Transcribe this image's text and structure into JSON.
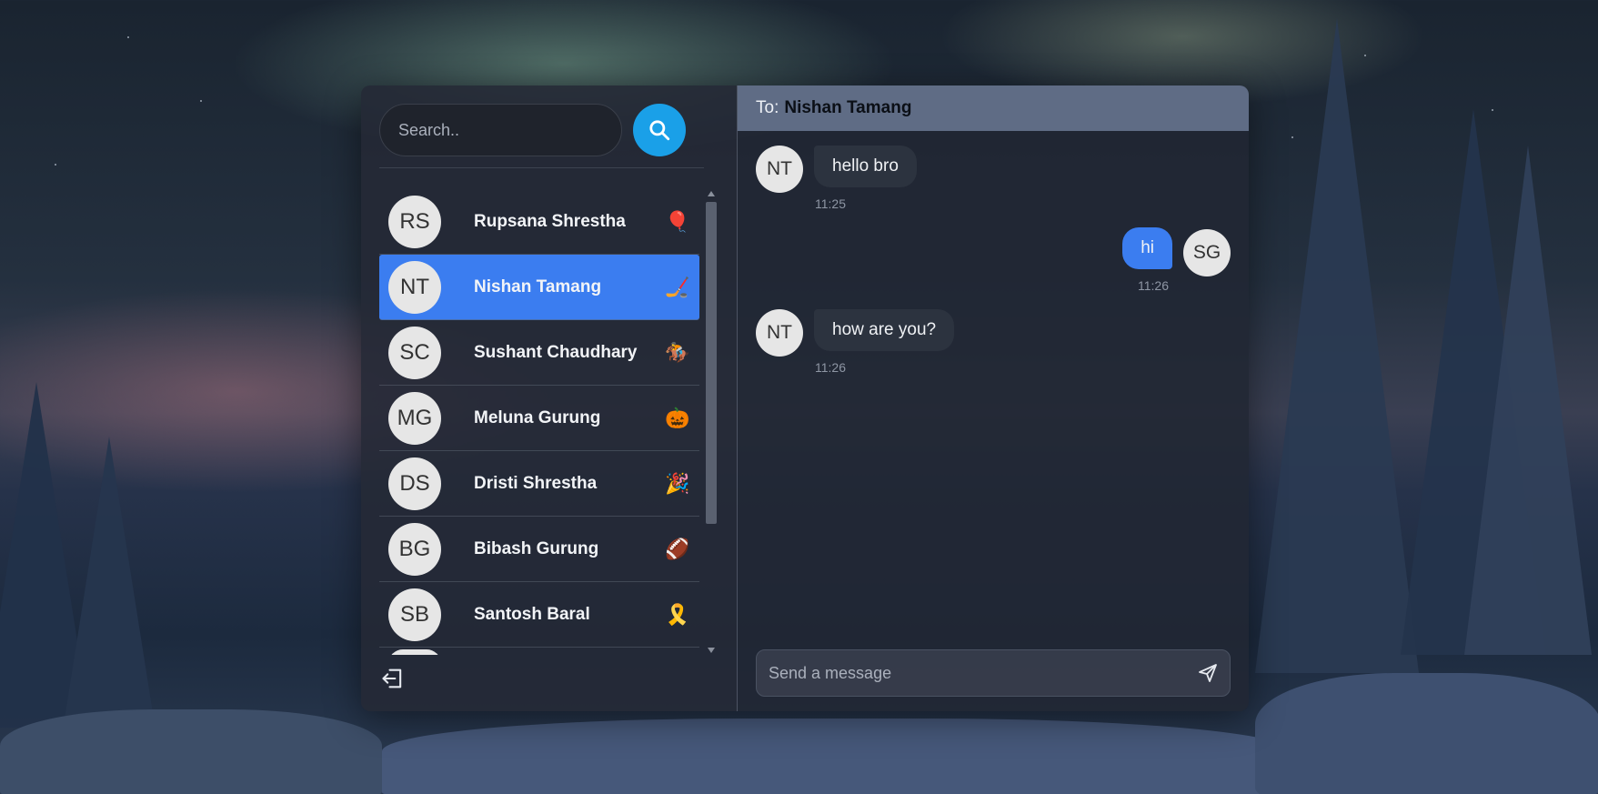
{
  "search": {
    "placeholder": "Search.."
  },
  "contacts": [
    {
      "initials": "RS",
      "name": "Rupsana Shrestha",
      "emoji": "🎈",
      "emoji_name": "balloon-icon"
    },
    {
      "initials": "NT",
      "name": "Nishan Tamang",
      "emoji": "🏒",
      "emoji_name": "hockey-icon",
      "active": true
    },
    {
      "initials": "SC",
      "name": "Sushant Chaudhary",
      "emoji": "🏇",
      "emoji_name": "horse-racing-icon"
    },
    {
      "initials": "MG",
      "name": "Meluna Gurung",
      "emoji": "🎃",
      "emoji_name": "pumpkin-icon"
    },
    {
      "initials": "DS",
      "name": "Dristi Shrestha",
      "emoji": "🎉",
      "emoji_name": "party-popper-icon"
    },
    {
      "initials": "BG",
      "name": "Bibash Gurung",
      "emoji": "🏈",
      "emoji_name": "football-icon"
    },
    {
      "initials": "SB",
      "name": "Santosh Baral",
      "emoji": "🎗️",
      "emoji_name": "ribbon-icon"
    }
  ],
  "chat": {
    "to_label": "To:",
    "to_name": "Nishan Tamang",
    "messages": [
      {
        "direction": "in",
        "initials": "NT",
        "text": "hello bro",
        "time": "11:25"
      },
      {
        "direction": "out",
        "initials": "SG",
        "text": "hi",
        "time": "11:26"
      },
      {
        "direction": "in",
        "initials": "NT",
        "text": "how are you?",
        "time": "11:26"
      }
    ],
    "composer_placeholder": "Send a message"
  },
  "colors": {
    "accent": "#3b7df0",
    "search_button": "#1aa0e8",
    "header": "#5f6c85"
  }
}
